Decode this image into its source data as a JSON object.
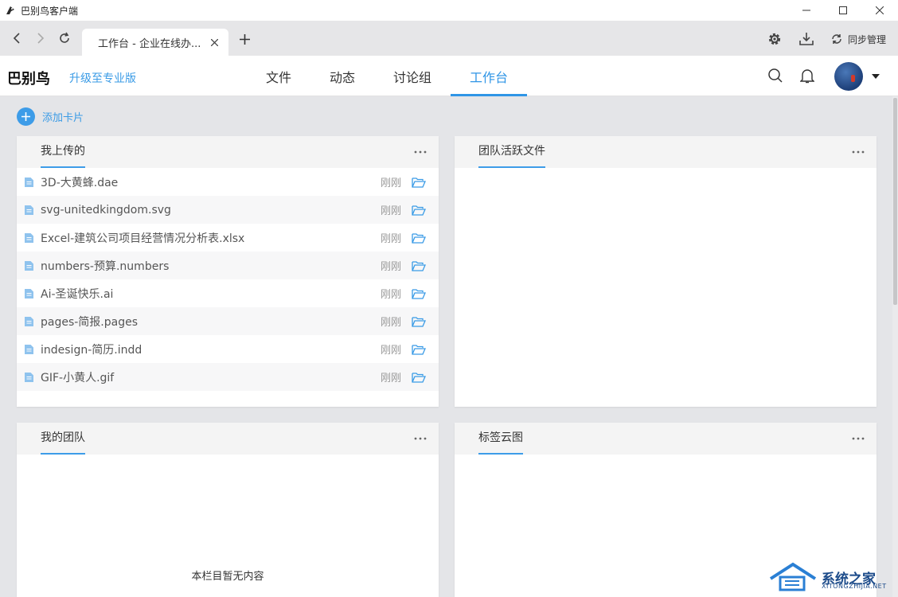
{
  "window": {
    "title": "巴别鸟客户端"
  },
  "browser": {
    "tab_label": "工作台 - 企业在线办...",
    "sync_label": "同步管理"
  },
  "header": {
    "brand": "巴别鸟",
    "upgrade": "升级至专业版",
    "nav": [
      "文件",
      "动态",
      "讨论组",
      "工作台"
    ],
    "active_nav": "工作台"
  },
  "content": {
    "add_card_label": "添加卡片",
    "cards": {
      "my_uploads": {
        "title": "我上传的",
        "files": [
          {
            "name": "3D-大黄蜂.dae",
            "time": "刚刚"
          },
          {
            "name": "svg-unitedkingdom.svg",
            "time": "刚刚"
          },
          {
            "name": "Excel-建筑公司项目经营情况分析表.xlsx",
            "time": "刚刚"
          },
          {
            "name": "numbers-预算.numbers",
            "time": "刚刚"
          },
          {
            "name": "Ai-圣诞快乐.ai",
            "time": "刚刚"
          },
          {
            "name": "pages-简报.pages",
            "time": "刚刚"
          },
          {
            "name": "indesign-简历.indd",
            "time": "刚刚"
          },
          {
            "name": "GIF-小黄人.gif",
            "time": "刚刚"
          }
        ]
      },
      "team_active_files": {
        "title": "团队活跃文件"
      },
      "my_team": {
        "title": "我的团队",
        "empty_message": "本栏目暂无内容"
      },
      "tag_cloud": {
        "title": "标签云图"
      }
    }
  },
  "watermark": {
    "text": "系统之家",
    "sub": "XITONGZHIJIA.NET"
  },
  "colors": {
    "accent": "#2f95e6",
    "background": "#e4e5e8"
  }
}
